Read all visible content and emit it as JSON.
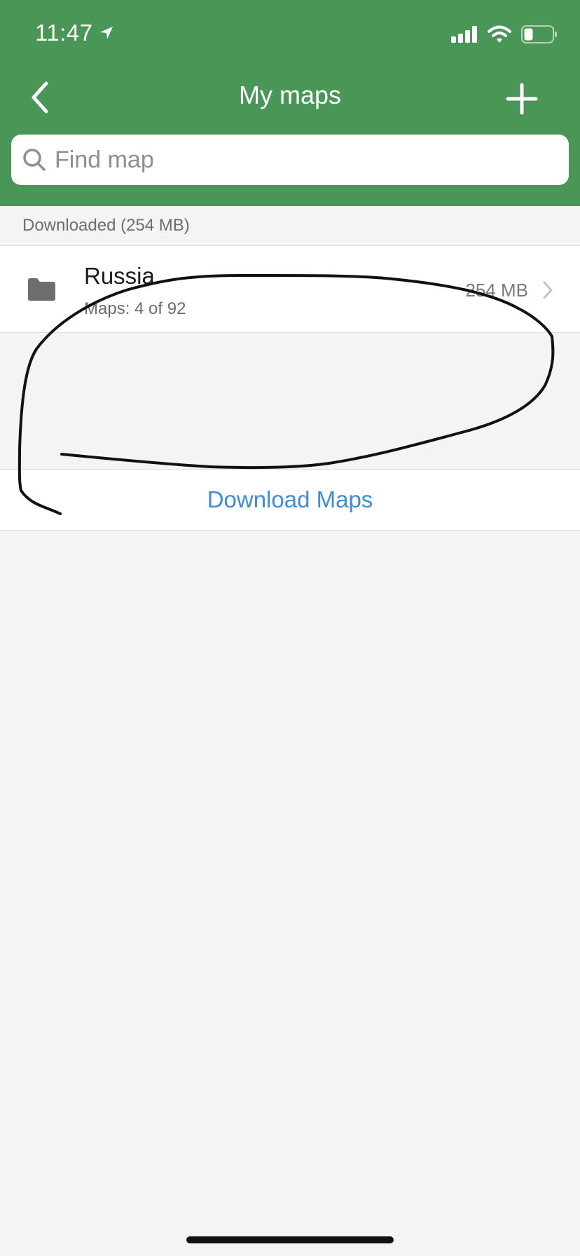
{
  "status_bar": {
    "time": "11:47"
  },
  "nav": {
    "title": "My maps"
  },
  "search": {
    "placeholder": "Find map",
    "value": ""
  },
  "downloaded_section": {
    "header": "Downloaded (254 MB)",
    "items": [
      {
        "title": "Russia",
        "subtitle": "Maps: 4 of 92",
        "size": "254 MB"
      }
    ]
  },
  "download_button": {
    "label": "Download Maps"
  },
  "colors": {
    "header_green": "#4a9657",
    "link_blue": "#3d8ddc",
    "background": "#f4f4f4"
  },
  "icons": [
    "location-arrow-icon",
    "signal-icon",
    "wifi-icon",
    "battery-icon",
    "back-chevron-icon",
    "plus-icon",
    "search-icon",
    "folder-icon",
    "chevron-right-icon"
  ]
}
